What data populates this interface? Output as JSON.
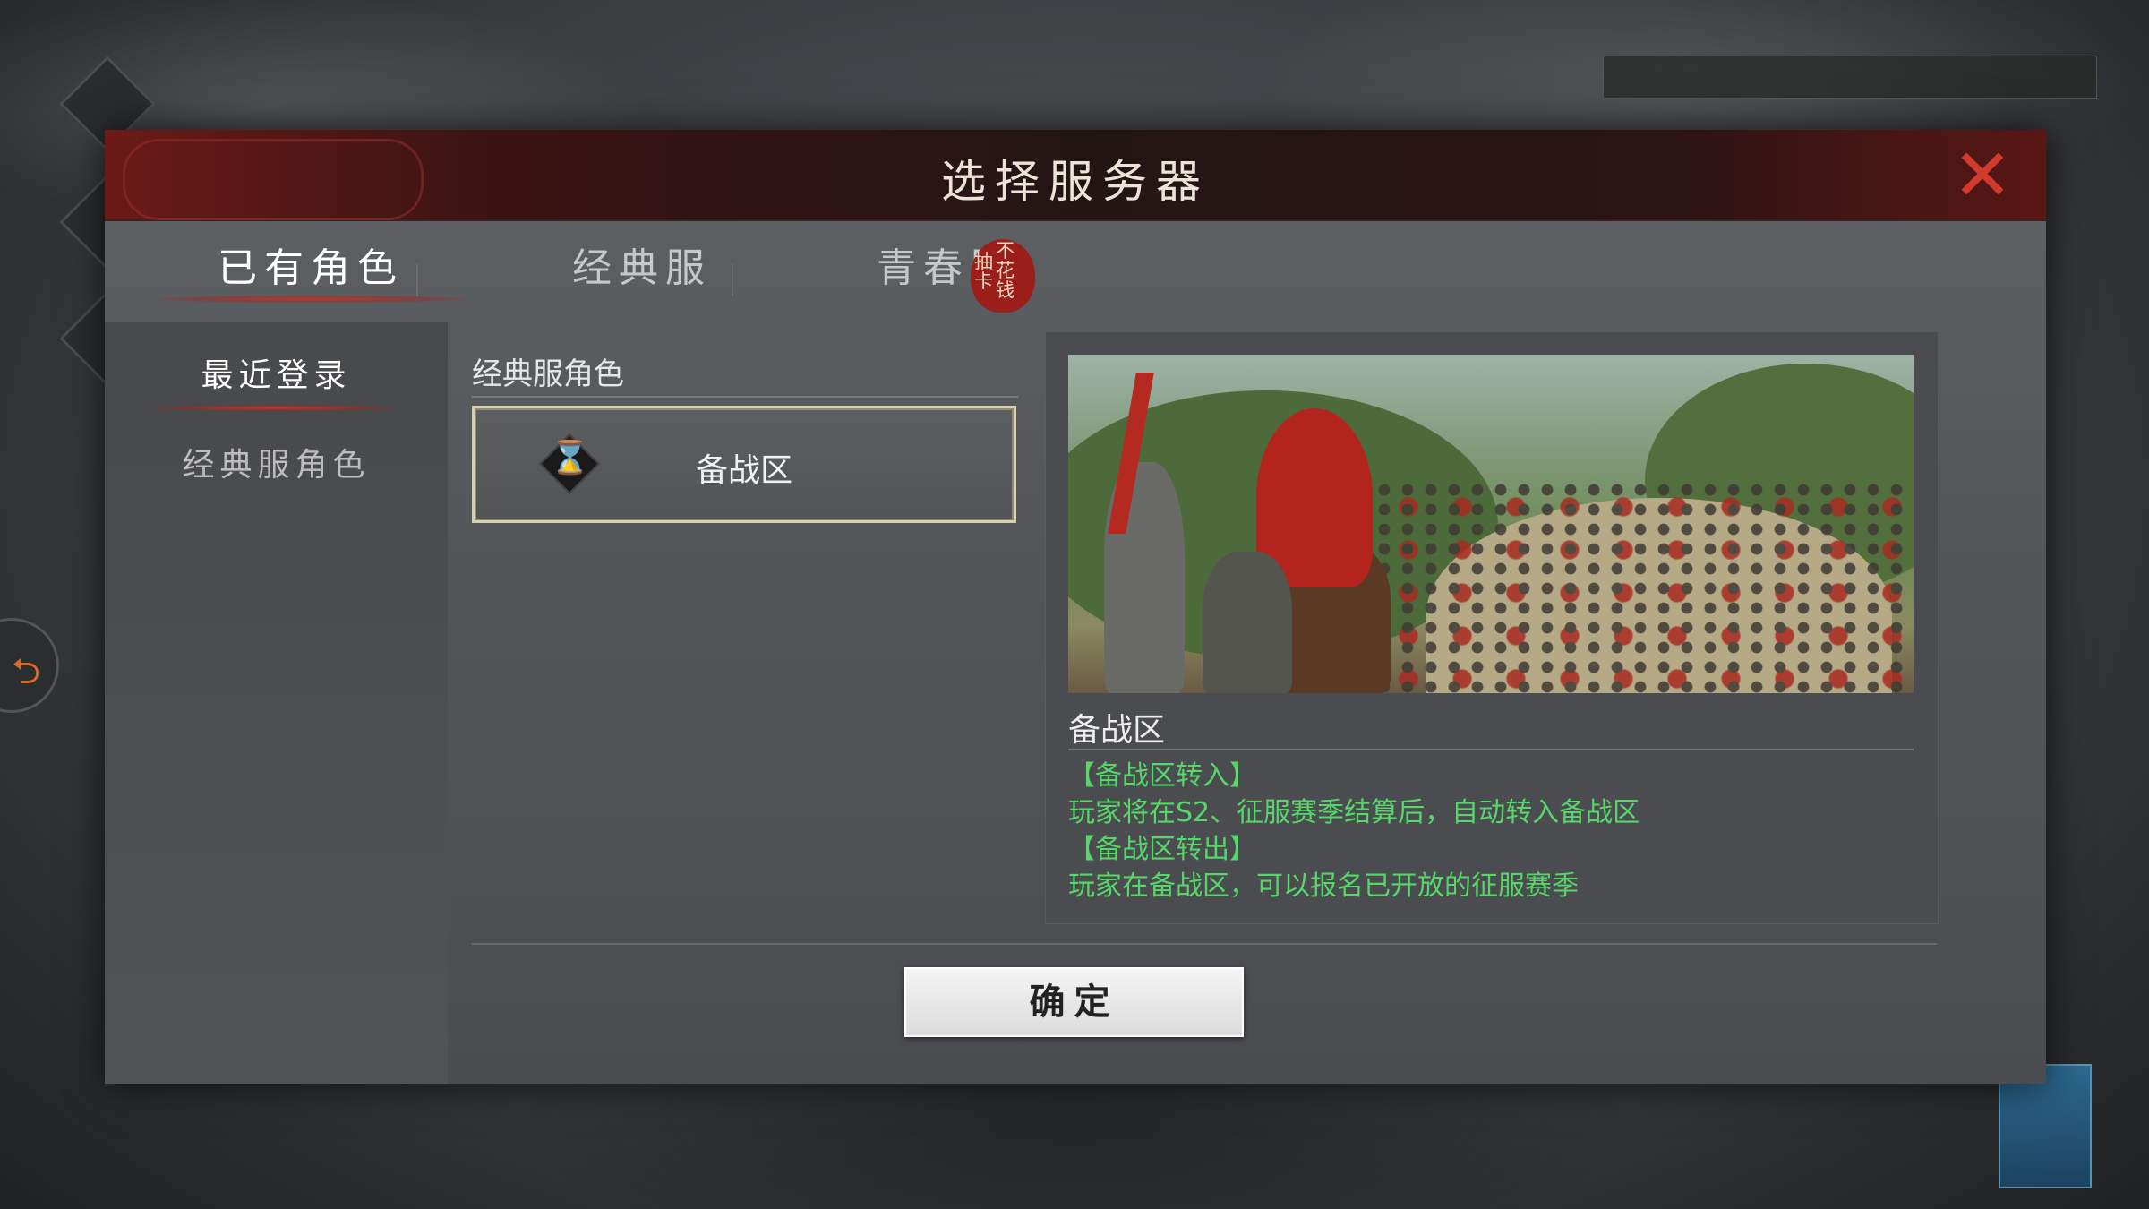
{
  "dialog": {
    "title": "选择服务器",
    "close_icon": "close-icon"
  },
  "tabs": [
    {
      "label": "已有角色",
      "active": true
    },
    {
      "label": "经典服",
      "active": false
    },
    {
      "label": "青春服",
      "active": false,
      "badge": [
        "不",
        "抽卡",
        "花",
        "钱"
      ]
    }
  ],
  "sidebar": {
    "items": [
      {
        "label": "最近登录",
        "active": true
      },
      {
        "label": "经典服角色",
        "active": false
      }
    ]
  },
  "server_list": {
    "section_label": "经典服角色",
    "servers": [
      {
        "name": "备战区",
        "icon": "hourglass-icon",
        "selected": true
      }
    ]
  },
  "info": {
    "title": "备战区",
    "lines": [
      "【备战区转入】",
      "玩家将在S2、征服赛季结算后，自动转入备战区",
      "【备战区转出】",
      "玩家在备战区，可以报名已开放的征服赛季"
    ],
    "text_color": "#57d76a"
  },
  "confirm": {
    "label": "确定"
  },
  "colors": {
    "accent_red": "#c0342a",
    "header_bg": "#241515",
    "selected_border": "#d5cfae"
  }
}
